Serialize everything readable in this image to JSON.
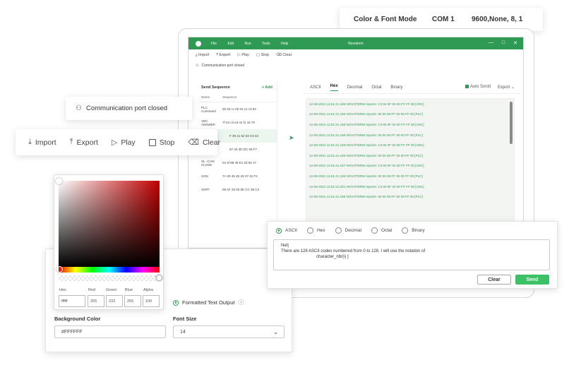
{
  "mode_bar": {
    "title": "Color & Font Mode",
    "port": "COM 1",
    "settings": "9600,None, 8, 1"
  },
  "app": {
    "title": "Novoterm",
    "menu": [
      "File",
      "Edit",
      "Run",
      "Tools",
      "Help"
    ],
    "window_controls": [
      "—",
      "□",
      "✕"
    ],
    "toolbar": [
      "Import",
      "Export",
      "Play",
      "Stop",
      "Clear"
    ],
    "status": "Communication port closed",
    "send_sequence": {
      "title": "Send Sequence",
      "add_label": "+ Add",
      "columns": [
        "Name",
        "Sequence"
      ],
      "rows": [
        {
          "name": "PLC Command",
          "seq": "2b 03 cc 00 04 c4 c3 03"
        },
        {
          "name": "VDC ANSWER",
          "seq": "7f 44 c3 e3 41 f1 16 70"
        },
        {
          "name": "",
          "seq": "F 39 41 52 53 C6 53"
        },
        {
          "name": "",
          "seq": "67 A5 4D DC 06 F7"
        },
        {
          "name": "SL –CAN CLOSE",
          "seq": "04 4f 88 49 E1 53 56 17"
        },
        {
          "name": "XON",
          "seq": "7A 30 45 2E 28 07 42 F2"
        },
        {
          "name": "XOFF",
          "seq": "05 AF 33 00 0E CC 38 C3"
        }
      ]
    },
    "tabs": [
      "ASCII",
      "Hex",
      "Decimal",
      "Octal",
      "Binary"
    ],
    "active_tab": "Hex",
    "auto_scroll": "Auto Scroll",
    "export_label": "Export",
    "log": [
      "12-08-2021 11:51:21.185 NOVOTERM reports: C3 60 0F 03 00 FF FF 00 [VDC]",
      "12-08-2021 11:51:21.186 NOVOTERM reports: 00 00 06 FF 00 00 FF 00 [PLC]",
      "12-08-2021 11:51:21.190 NOVOTERM reports: C3 60 0F 03 00 FF FF 00 [VDC]",
      "12-08-2021 11:51:21.186 NOVOTERM reports: 00 00 06 FF 00 00 FF 00 [PLC]",
      "12-08-2021 11:51:21.193 NOVOTERM reports: C3 60 0F 03 00 FF FF 00 [VDC]",
      "12-08-2021 11:51:21.186 NOVOTERM reports: 00 00 06 FF 00 00 FF 00 [PLC]",
      "12-08-2021 11:51:21.197 NOVOTERM reports: C3 60 0F 03 00 FF FF 00 [VDC]",
      "12-08-2021 11:51:21.186 NOVOTERM reports: 00 00 06 FF 00 00 FF 00 [PLC]",
      "12-08-2021 11:51:21.201 NOVOTERM reports: C3 60 0F 03 00 FF FF 00 [VDC]",
      "12-08-2021 11:51:21.186 NOVOTERM reports: 00 00 06 FF 00 00 FF 00 [PLC]"
    ]
  },
  "conn_popup": {
    "icon": "plug-icon",
    "text": "Communication port closed"
  },
  "toolbar_popup": {
    "import": "Import",
    "export": "Export",
    "play": "Play",
    "stop": "Stop",
    "clear": "Clear"
  },
  "picker": {
    "labels": {
      "hex": "Hex",
      "red": "Red",
      "green": "Green",
      "blue": "Blue",
      "alpha": "Alpha"
    },
    "values": {
      "hex": "ffffff",
      "red": "255",
      "green": "233",
      "blue": "255",
      "alpha": "100"
    },
    "hue_color": "#c00000"
  },
  "settings": {
    "formatted_output": "Formatted Text Output",
    "bg_label": "Background Color",
    "bg_value": "#FFFFFF",
    "font_label": "Font Size",
    "font_value": "14"
  },
  "send_panel": {
    "formats": [
      "ASCII",
      "Hex",
      "Decimal",
      "Octal",
      "Binary"
    ],
    "selected_format": "ASCII",
    "text": "Net|\nThere are 128 ASCII codes numbered from 0 to 128. I will use the notation of\n                              character_nbr(i) ]",
    "clear": "Clear",
    "send": "Send"
  },
  "colors": {
    "accent": "#2f9a53",
    "send_button": "#3cc264"
  }
}
